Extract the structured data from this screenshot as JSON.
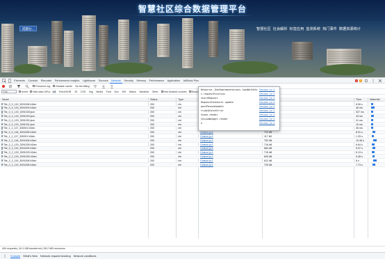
{
  "hero": {
    "title": "智慧社区综合数据管理平台",
    "city_select": "成都分...",
    "nav": [
      "智慧社区",
      "社会解析",
      "标签应用",
      "监测系统",
      "热门事件",
      "数据资源统计"
    ]
  },
  "devtools": {
    "tabs": [
      "Elements",
      "Console",
      "Recorder",
      "Performance insights",
      "Lighthouse",
      "Sources",
      "Network",
      "Security",
      "Memory",
      "Performance",
      "Application",
      "AdBlock Plus",
      "Application",
      "Recorder"
    ],
    "active_tab": "Network",
    "badges": {
      "errors": "1",
      "warnings": "5"
    },
    "toolbar1": {
      "preserve_log": "Preserve log",
      "disable_cache": "Disable cache",
      "throttle": "No throttling"
    },
    "toolbar2": {
      "filter_placeholder": "Filter",
      "invert": "Invert",
      "hide_data": "Hide data URLs",
      "types": [
        "All",
        "Fetch/XHR",
        "JS",
        "CSS",
        "Img",
        "Media",
        "Font",
        "Doc",
        "WS",
        "Wasm",
        "Manifest",
        "Other"
      ],
      "blocked_cookies": "Has blocked cookies",
      "blocked_requests": "Blocked Requests",
      "third_party": "3rd-party requests"
    },
    "columns": {
      "name": "Name",
      "status": "Status",
      "type": "Type",
      "initiator": "Initiator",
      "size": "Size",
      "time": "Time",
      "waterfall": "Waterfall"
    },
    "rows": [
      {
        "name": "Tile_0_0_119_3091008 b3dm",
        "status": "200",
        "type": "xhr",
        "initiator": "",
        "size": "",
        "time": "8.06 s"
      },
      {
        "name": "Tile_0_0_119_3091009 b3dm",
        "status": "200",
        "type": "xhr",
        "initiator": "",
        "size": "",
        "time": "46 ms"
      },
      {
        "name": "Tile_0_0_120_3091028 json",
        "status": "200",
        "type": "xhr",
        "initiator": "",
        "size": "",
        "time": "537 ms"
      },
      {
        "name": "Tile_0_0_120_3091029 json",
        "status": "200",
        "type": "xhr",
        "initiator": "",
        "size": "",
        "time": "43 ms"
      },
      {
        "name": "Tile_0_0_120_3091030 json",
        "status": "200",
        "type": "xhr",
        "initiator": "",
        "size": "",
        "time": "41 ms"
      },
      {
        "name": "Tile_0_0_120_3091031 json",
        "status": "200",
        "type": "xhr",
        "initiator": "",
        "size": "",
        "time": "10 ms"
      },
      {
        "name": "Tile_1_1_117_300001 b3dm",
        "status": "200",
        "type": "xhr",
        "initiator": "",
        "size": "",
        "time": "46 ms"
      },
      {
        "name": "Tile_0_0_118_3091008 b3dm",
        "status": "200",
        "type": "xhr",
        "initiator": "Cesium.js:1",
        "size": "712 kB",
        "time": "8.51 s"
      },
      {
        "name": "Tile_1_1_117_300001 b3dm",
        "status": "200",
        "type": "xhr",
        "initiator": "Cesium.js:1",
        "size": "117 kB",
        "time": "1.25 s"
      },
      {
        "name": "Tile_2_2_118_3091008 b3dm",
        "status": "200",
        "type": "xhr",
        "initiator": "Cesium.js:1",
        "size": "752 kB",
        "time": "10.48 s"
      },
      {
        "name": "Tile_2_2_120_3091028 b3dm",
        "status": "200",
        "type": "xhr",
        "initiator": "Cesium.js:1",
        "size": "716 kB",
        "time": "6.84 s"
      },
      {
        "name": "Tile_2_2_119_3091009 b3dm",
        "status": "200",
        "type": "xhr",
        "initiator": "Cesium.js:1",
        "size": "684 kB",
        "time": "5.97 s"
      },
      {
        "name": "Tile_2_2_120_3091029 b3dm",
        "status": "200",
        "type": "xhr",
        "initiator": "Cesium.js:1",
        "size": "715 kB",
        "time": "6.13 s"
      },
      {
        "name": "Tile_2_2_120_3091030 b3dm",
        "status": "200",
        "type": "xhr",
        "initiator": "Cesium.js:1",
        "size": "693 kB",
        "time": "5.48 s"
      },
      {
        "name": "Tile_2_2_119_3091008 b3dm",
        "status": "200",
        "type": "xhr",
        "initiator": "Cesium.js:1",
        "size": "812 kB",
        "time": "8 s"
      },
      {
        "name": "Tile_2_2_119_3091008 b3dm",
        "status": "200",
        "type": "xhr",
        "initiator": "Cesium.js:1",
        "size": "725 kB",
        "time": "7.73 s"
      }
    ],
    "popup_stack": [
      {
        "fn": "Resource._DeeImplementations.loadWithXhr",
        "src": "Cesium.js:1"
      },
      {
        "fn": "c.requestFunction",
        "src": "Cesium.js:1"
      },
      {
        "fn": "startRequest",
        "src": "Cesium.js:1"
      },
      {
        "fn": "RequestScheduler.update",
        "src": "Cesium.js:1"
      },
      {
        "fn": "postPassesUpdate",
        "src": "Cesium.js:1"
      },
      {
        "fn": "tryAndCatchError",
        "src": "Cesium.js:1"
      },
      {
        "fn": "Scene.render",
        "src": "Cesium.js:1"
      },
      {
        "fn": "CesiumWidget.render",
        "src": "Cesium.js:1"
      },
      {
        "fn": "e",
        "src": "Cesium.js:1"
      }
    ],
    "status": "454 requests | 40.1 MB transferred | 56.2 MB resources",
    "drawer_tabs": [
      "Console",
      "What's New",
      "Network request blocking",
      "Network conditions"
    ],
    "drawer_active": "Console"
  },
  "colors": {
    "accent": "#1a73e8",
    "hero_title": "#eaf4ff",
    "link": "#1a5fb4",
    "record": "#d93025",
    "waterfall": "#2f7de1"
  }
}
